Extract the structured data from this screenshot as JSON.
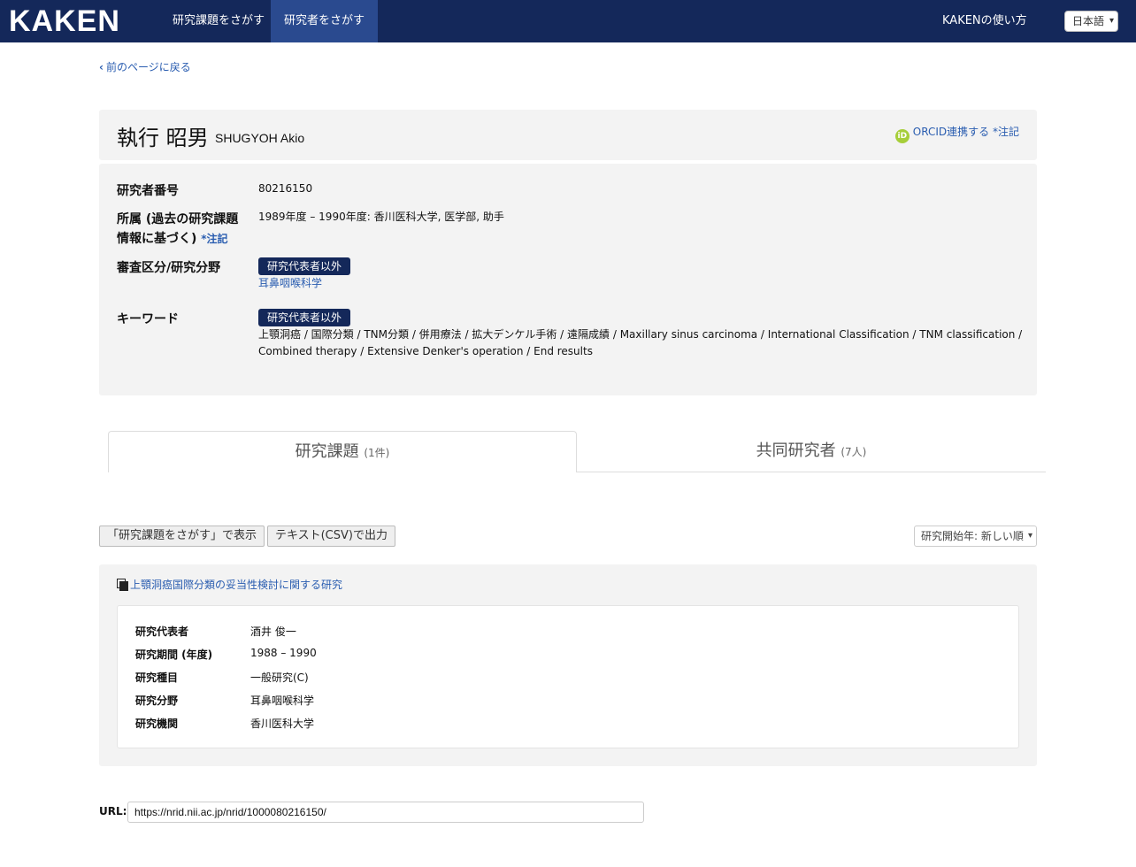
{
  "navbar": {
    "logo": "KAKEN",
    "items": [
      {
        "label": "研究課題をさがす"
      },
      {
        "label": "研究者をさがす"
      }
    ],
    "help": "KAKENの使い方",
    "language": "日本語"
  },
  "back_link": "前のページに戻る",
  "researcher": {
    "name_ja": "執行 昭男",
    "name_en": "SHUGYOH Akio",
    "orcid_label": "ORCID連携する",
    "orcid_note": "*注記"
  },
  "info": {
    "id_label": "研究者番号",
    "id_value": "80216150",
    "affiliation_label_1": "所属 (過去の研究課題",
    "affiliation_label_2": "情報に基づく)",
    "affiliation_note": "*注記",
    "affiliation_value": "1989年度 – 1990年度: 香川医科大学, 医学部, 助手",
    "field_label": "審査区分/研究分野",
    "field_badge": "研究代表者以外",
    "field_value": "耳鼻咽喉科学",
    "keyword_label": "キーワード",
    "keyword_badge": "研究代表者以外",
    "keyword_line1": "上顎洞癌 / 国際分類 / TNM分類 / 併用療法 / 拡大デンケル手術 / 遠隔成績 / Maxillary sinus carcinoma / International Classification / TNM classification /",
    "keyword_line2": "Combined therapy / Extensive Denker's operation / End results"
  },
  "tabs": [
    {
      "label": "研究課題",
      "count": "(1件)"
    },
    {
      "label": "共同研究者",
      "count": "(7人)"
    }
  ],
  "actions": {
    "search_btn": "「研究課題をさがす」で表示",
    "csv_btn": "テキスト(CSV)で出力",
    "sort": "研究開始年: 新しい順"
  },
  "project": {
    "title": "上顎洞癌国際分類の妥当性検討に関する研究",
    "rows": [
      {
        "key": "研究代表者",
        "value": "酒井 俊一"
      },
      {
        "key": "研究期間 (年度)",
        "value": "1988 – 1990"
      },
      {
        "key": "研究種目",
        "value": "一般研究(C)"
      },
      {
        "key": "研究分野",
        "value": "耳鼻咽喉科学"
      },
      {
        "key": "研究機関",
        "value": "香川医科大学"
      }
    ]
  },
  "url": {
    "label": "URL:",
    "value": "https://nrid.nii.ac.jp/nrid/1000080216150/"
  }
}
